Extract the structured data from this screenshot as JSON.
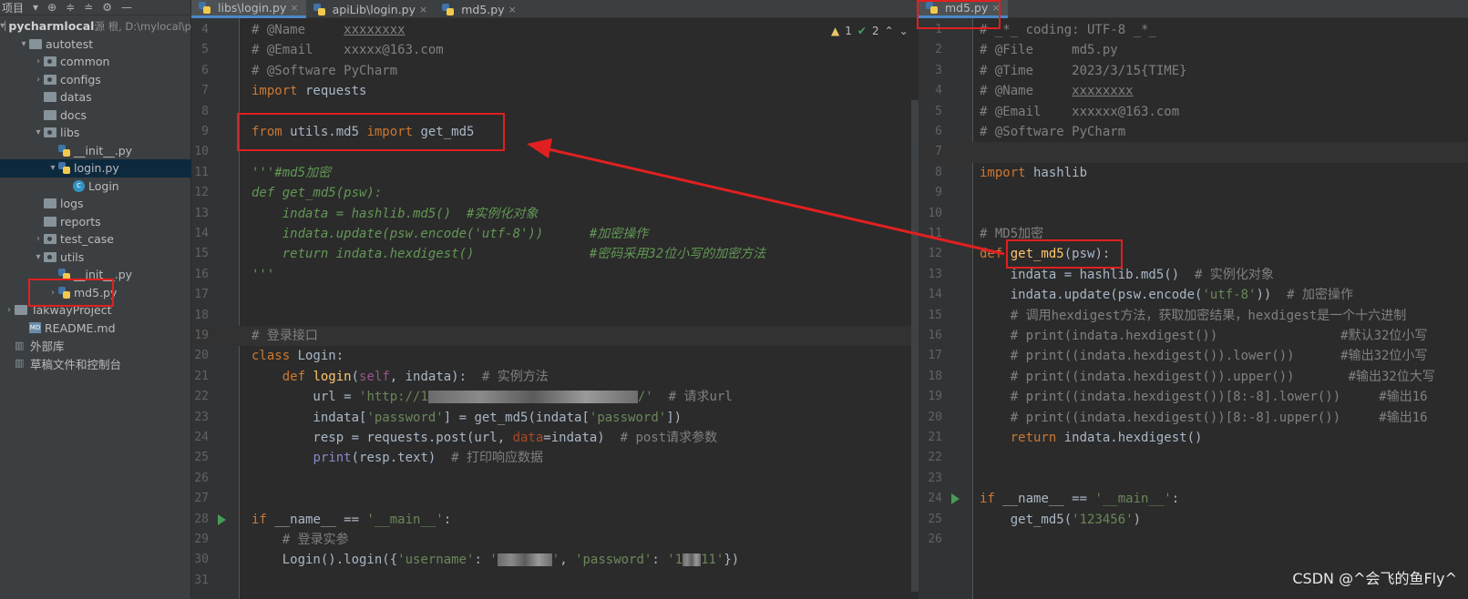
{
  "project_panel": {
    "label": "项目",
    "items": [
      {
        "arrow": "▾",
        "indent": 0,
        "icon": "folder",
        "label": "pycharmlocal",
        "extra": " 源 根,  D:\\mylocal\\p",
        "bold": true
      },
      {
        "arrow": "▾",
        "indent": 1,
        "icon": "folder",
        "label": "autotest"
      },
      {
        "arrow": "›",
        "indent": 2,
        "icon": "pkg",
        "label": "common"
      },
      {
        "arrow": "›",
        "indent": 2,
        "icon": "pkg",
        "label": "configs"
      },
      {
        "arrow": "",
        "indent": 2,
        "icon": "folder",
        "label": "datas"
      },
      {
        "arrow": "",
        "indent": 2,
        "icon": "folder",
        "label": "docs"
      },
      {
        "arrow": "▾",
        "indent": 2,
        "icon": "pkg",
        "label": "libs"
      },
      {
        "arrow": "",
        "indent": 3,
        "icon": "py",
        "label": "__init__.py"
      },
      {
        "arrow": "▾",
        "indent": 3,
        "icon": "py",
        "label": "login.py",
        "selected": true
      },
      {
        "arrow": "",
        "indent": 4,
        "icon": "class",
        "label": "Login"
      },
      {
        "arrow": "",
        "indent": 2,
        "icon": "folder",
        "label": "logs"
      },
      {
        "arrow": "",
        "indent": 2,
        "icon": "folder",
        "label": "reports"
      },
      {
        "arrow": "›",
        "indent": 2,
        "icon": "pkg",
        "label": "test_case"
      },
      {
        "arrow": "▾",
        "indent": 2,
        "icon": "pkg",
        "label": "utils"
      },
      {
        "arrow": "",
        "indent": 3,
        "icon": "py",
        "label": "__init__.py"
      },
      {
        "arrow": "›",
        "indent": 3,
        "icon": "py",
        "label": "md5.py"
      },
      {
        "arrow": "›",
        "indent": 0,
        "icon": "folder",
        "label": "TakwayProject"
      },
      {
        "arrow": "",
        "indent": 1,
        "icon": "md",
        "label": "README.md"
      },
      {
        "arrow": "",
        "indent": 0,
        "icon": "lib",
        "label": "外部库"
      },
      {
        "arrow": "",
        "indent": 0,
        "icon": "lib",
        "label": "草稿文件和控制台"
      }
    ]
  },
  "left_tabs": [
    {
      "label": "libs\\login.py",
      "active": true
    },
    {
      "label": "apiLib\\login.py",
      "active": false
    },
    {
      "label": "md5.py",
      "active": false
    }
  ],
  "right_tabs": [
    {
      "label": "md5.py",
      "active": true
    }
  ],
  "inspections": {
    "warnings": "1",
    "ok": "2"
  },
  "left_editor": {
    "lines": [
      {
        "n": "4",
        "t": [
          [
            "c",
            "# @Name     "
          ],
          [
            "cu",
            "xxxxxxxx"
          ]
        ]
      },
      {
        "n": "5",
        "t": [
          [
            "c",
            "# @Email    xxxxx@163.com"
          ]
        ]
      },
      {
        "n": "6",
        "t": [
          [
            "c",
            "# @Software PyCharm"
          ]
        ]
      },
      {
        "n": "7",
        "t": [
          [
            "k",
            "import"
          ],
          [
            "p",
            " requests"
          ]
        ]
      },
      {
        "n": "8",
        "t": []
      },
      {
        "n": "9",
        "t": [
          [
            "k",
            "from"
          ],
          [
            "p",
            " utils.md5 "
          ],
          [
            "k",
            "import"
          ],
          [
            "p",
            " get_md5"
          ]
        ]
      },
      {
        "n": "10",
        "t": []
      },
      {
        "n": "11",
        "t": [
          [
            "d",
            "'''#md5加密"
          ]
        ]
      },
      {
        "n": "12",
        "t": [
          [
            "d",
            "def get_md5(psw):"
          ]
        ]
      },
      {
        "n": "13",
        "t": [
          [
            "d",
            "    indata = hashlib.md5()  #实例化对象"
          ]
        ]
      },
      {
        "n": "14",
        "t": [
          [
            "d",
            "    indata.update(psw.encode('utf-8'))      #加密操作"
          ]
        ]
      },
      {
        "n": "15",
        "t": [
          [
            "d",
            "    return indata.hexdigest()               #密码采用32位小写的加密方法"
          ]
        ]
      },
      {
        "n": "16",
        "t": [
          [
            "d",
            "'''"
          ]
        ]
      },
      {
        "n": "17",
        "t": []
      },
      {
        "n": "18",
        "t": []
      },
      {
        "n": "19",
        "t": [
          [
            "c",
            "# 登录接口"
          ]
        ],
        "cur": true
      },
      {
        "n": "20",
        "t": [
          [
            "k",
            "class "
          ],
          [
            "p",
            "Login:"
          ]
        ]
      },
      {
        "n": "21",
        "t": [
          [
            "p",
            "    "
          ],
          [
            "k",
            "def "
          ],
          [
            "fn",
            "login"
          ],
          [
            "p",
            "("
          ],
          [
            "sf",
            "self"
          ],
          [
            "p",
            ", indata):  "
          ],
          [
            "c",
            "# 实例方法"
          ]
        ]
      },
      {
        "n": "22",
        "t": [
          [
            "p",
            "        url = "
          ],
          [
            "s",
            "'http://1"
          ],
          [
            "blur",
            "230"
          ],
          [
            "s",
            "/'"
          ],
          [
            "p",
            "  "
          ],
          [
            "c",
            "# 请求url"
          ]
        ]
      },
      {
        "n": "23",
        "t": [
          [
            "p",
            "        indata["
          ],
          [
            "s",
            "'password'"
          ],
          [
            "p",
            "] = get_md5(indata["
          ],
          [
            "s",
            "'password'"
          ],
          [
            "p",
            "])"
          ]
        ]
      },
      {
        "n": "24",
        "t": [
          [
            "p",
            "        resp = requests.post(url, "
          ],
          [
            "kw",
            "data"
          ],
          [
            "p",
            "=indata)  "
          ],
          [
            "c",
            "# post请求参数"
          ]
        ]
      },
      {
        "n": "25",
        "t": [
          [
            "p",
            "        "
          ],
          [
            "bi",
            "print"
          ],
          [
            "p",
            "(resp.text)  "
          ],
          [
            "c",
            "# 打印响应数据"
          ]
        ]
      },
      {
        "n": "26",
        "t": []
      },
      {
        "n": "27",
        "t": []
      },
      {
        "n": "28",
        "t": [
          [
            "k",
            "if "
          ],
          [
            "p",
            "__name__ == "
          ],
          [
            "s",
            "'__main__'"
          ],
          [
            "p",
            ":"
          ]
        ],
        "run": true
      },
      {
        "n": "29",
        "t": [
          [
            "p",
            "    "
          ],
          [
            "c",
            "# 登录实参"
          ]
        ]
      },
      {
        "n": "30",
        "t": [
          [
            "p",
            "    Login().login({"
          ],
          [
            "s",
            "'username'"
          ],
          [
            "p",
            ": "
          ],
          [
            "s",
            "'"
          ],
          [
            "blur",
            "60"
          ],
          [
            "s",
            "'"
          ],
          [
            "p",
            ", "
          ],
          [
            "s",
            "'password'"
          ],
          [
            "p",
            ": "
          ],
          [
            "s",
            "'1"
          ],
          [
            "blur",
            "20"
          ],
          [
            "s",
            "11'"
          ],
          [
            "p",
            "})"
          ]
        ]
      },
      {
        "n": "31",
        "t": []
      }
    ]
  },
  "right_editor": {
    "lines": [
      {
        "n": "1",
        "t": [
          [
            "c",
            "# _*_ coding: UTF-8 _*_"
          ]
        ]
      },
      {
        "n": "2",
        "t": [
          [
            "c",
            "# @File     md5.py"
          ]
        ]
      },
      {
        "n": "3",
        "t": [
          [
            "c",
            "# @Time     2023/3/15{TIME}"
          ]
        ]
      },
      {
        "n": "4",
        "t": [
          [
            "c",
            "# @Name     "
          ],
          [
            "cu",
            "xxxxxxxx"
          ]
        ]
      },
      {
        "n": "5",
        "t": [
          [
            "c",
            "# @Email    xxxxxx@163.com"
          ]
        ]
      },
      {
        "n": "6",
        "t": [
          [
            "c",
            "# @Software PyCharm"
          ]
        ]
      },
      {
        "n": "7",
        "t": [],
        "cur": true
      },
      {
        "n": "8",
        "t": [
          [
            "k",
            "import"
          ],
          [
            "p",
            " hashlib"
          ]
        ]
      },
      {
        "n": "9",
        "t": []
      },
      {
        "n": "10",
        "t": []
      },
      {
        "n": "11",
        "t": [
          [
            "c",
            "# MD5加密"
          ]
        ]
      },
      {
        "n": "12",
        "t": [
          [
            "k",
            "def "
          ],
          [
            "fn",
            "get_md5"
          ],
          [
            "p",
            "(psw):"
          ]
        ]
      },
      {
        "n": "13",
        "t": [
          [
            "p",
            "    indata = hashlib.md5()  "
          ],
          [
            "c",
            "# 实例化对象"
          ]
        ]
      },
      {
        "n": "14",
        "t": [
          [
            "p",
            "    indata.update(psw.encode("
          ],
          [
            "s",
            "'utf-8'"
          ],
          [
            "p",
            "))  "
          ],
          [
            "c",
            "# 加密操作"
          ]
        ]
      },
      {
        "n": "15",
        "t": [
          [
            "c",
            "    # 调用hexdigest方法，获取加密结果，hexdigest是一个十六进制"
          ]
        ]
      },
      {
        "n": "16",
        "t": [
          [
            "c",
            "    # print(indata.hexdigest())                #默认32位小写"
          ]
        ]
      },
      {
        "n": "17",
        "t": [
          [
            "c",
            "    # print((indata.hexdigest()).lower())      #输出32位小写"
          ]
        ]
      },
      {
        "n": "18",
        "t": [
          [
            "c",
            "    # print((indata.hexdigest()).upper())       #输出32位大写"
          ]
        ]
      },
      {
        "n": "19",
        "t": [
          [
            "c",
            "    # print((indata.hexdigest())[8:-8].lower())     #输出16"
          ]
        ]
      },
      {
        "n": "20",
        "t": [
          [
            "c",
            "    # print((indata.hexdigest())[8:-8].upper())     #输出16"
          ]
        ]
      },
      {
        "n": "21",
        "t": [
          [
            "p",
            "    "
          ],
          [
            "k",
            "return"
          ],
          [
            "p",
            " indata.hexdigest()"
          ]
        ]
      },
      {
        "n": "22",
        "t": []
      },
      {
        "n": "23",
        "t": []
      },
      {
        "n": "24",
        "t": [
          [
            "k",
            "if "
          ],
          [
            "p",
            "__name__ == "
          ],
          [
            "s",
            "'__main__'"
          ],
          [
            "p",
            ":"
          ]
        ],
        "run": true
      },
      {
        "n": "25",
        "t": [
          [
            "p",
            "    get_md5("
          ],
          [
            "s",
            "'123456'"
          ],
          [
            "p",
            ")"
          ]
        ]
      },
      {
        "n": "26",
        "t": []
      }
    ]
  },
  "watermark": "CSDN @^会飞的鱼Fly^",
  "colors": {
    "annotation": "#e02020",
    "selection": "#0d293e",
    "tab_accent": "#4a88c7"
  }
}
